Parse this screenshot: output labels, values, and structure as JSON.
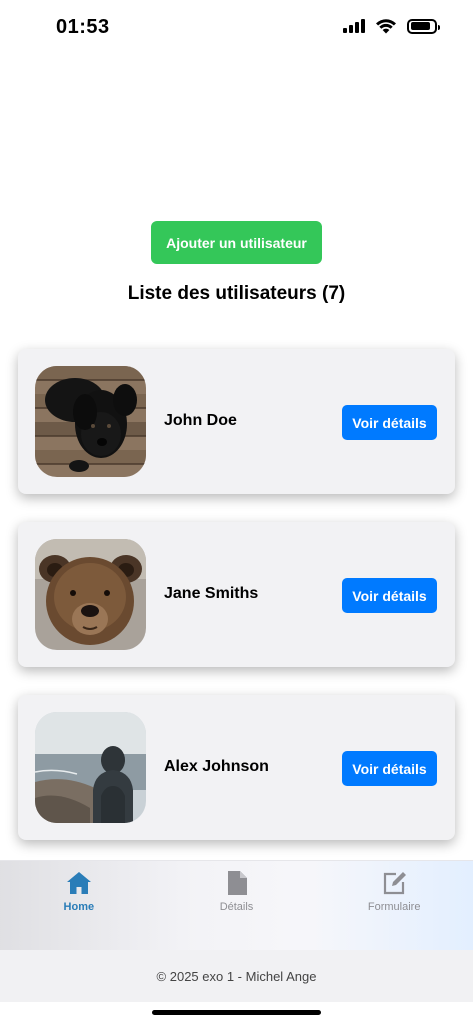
{
  "status": {
    "time": "01:53"
  },
  "add_button_label": "Ajouter un utilisateur",
  "list_title": "Liste des utilisateurs (7)",
  "users": [
    {
      "name": "John Doe",
      "button": "Voir détails",
      "avatar": "black-puppy-photo"
    },
    {
      "name": "Jane Smiths",
      "button": "Voir détails",
      "avatar": "brown-bear-photo"
    },
    {
      "name": "Alex Johnson",
      "button": "Voir détails",
      "avatar": "person-at-beach-photo"
    }
  ],
  "tabs": [
    {
      "label": "Home",
      "icon": "home-icon",
      "active": true
    },
    {
      "label": "Détails",
      "icon": "document-icon",
      "active": false
    },
    {
      "label": "Formulaire",
      "icon": "edit-icon",
      "active": false
    }
  ],
  "footer": "© 2025 exo 1 - Michel Ange",
  "colors": {
    "add_button": "#34c759",
    "details_button": "#007aff",
    "active_tab": "#2a7db8"
  }
}
